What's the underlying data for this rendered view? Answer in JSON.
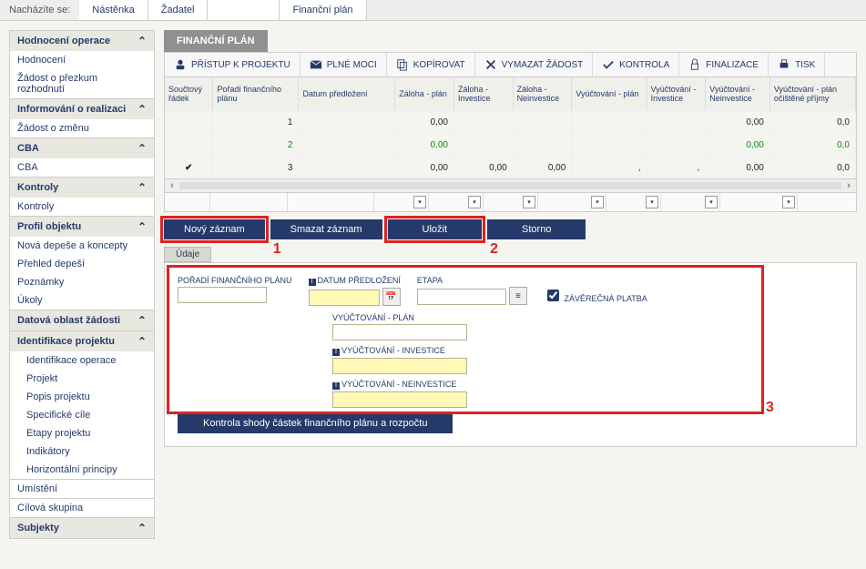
{
  "breadcrumb": {
    "label": "Nacházíte se:",
    "items": [
      "Nástěnka",
      "Žadatel",
      "",
      "Finanční plán"
    ]
  },
  "sidebar": [
    {
      "hd": "Hodnocení operace",
      "items": [
        "Hodnocení",
        "Žádost o přezkum rozhodnutí"
      ]
    },
    {
      "hd": "Informování o realizaci",
      "items": [
        "Žádost o změnu"
      ]
    },
    {
      "hd": "CBA",
      "items": [
        "CBA"
      ]
    },
    {
      "hd": "Kontroly",
      "items": [
        "Kontroly"
      ]
    },
    {
      "hd": "Profil objektu",
      "items": [
        "Nová depeše a koncepty",
        "Přehled depeší",
        "Poznámky",
        "Úkoly"
      ]
    },
    {
      "hd": "Datová oblast žádosti",
      "items": []
    },
    {
      "hd": "Identifikace projektu",
      "items": [
        "Identifikace operace",
        "Projekt",
        "Popis projektu",
        "Specifické cíle",
        "Etapy projektu",
        "Indikátory",
        "Horizontální principy"
      ],
      "sub": true
    },
    {
      "plain": [
        "Umístění",
        "Cílová skupina"
      ]
    },
    {
      "hd": "Subjekty",
      "items": []
    }
  ],
  "tab": "FINANČNÍ PLÁN",
  "toolbar": [
    "PŘÍSTUP K PROJEKTU",
    "PLNÉ MOCI",
    "KOPÍROVAT",
    "VYMAZAT ŽÁDOST",
    "KONTROLA",
    "FINALIZACE",
    "TISK"
  ],
  "gridcols": [
    "Součtový řádek",
    "Pořadí finančního plánu",
    "Datum předložení",
    "Záloha - plán",
    "Záloha - Investice",
    "Záloha - Neinvestice",
    "Vyúčtování - plán",
    "Vyúčtování - Investice",
    "Vyúčtování - Neinvestice",
    "Vyúčtování - plán očištěné příjmy"
  ],
  "rows": [
    {
      "c": [
        "",
        "1",
        "",
        "0,00",
        "",
        "",
        "",
        "",
        "0,00",
        "0,0"
      ]
    },
    {
      "c": [
        "",
        "2",
        "",
        "0,00",
        "",
        "",
        "",
        "",
        "0,00",
        "0,0"
      ]
    },
    {
      "c": [
        "✔",
        "3",
        "",
        "0,00",
        "0,00",
        "0,00",
        ",",
        ",",
        "0,00",
        "0,0"
      ]
    }
  ],
  "btns": {
    "novy": "Nový záznam",
    "smazat": "Smazat záznam",
    "ulozit": "Uložit",
    "storno": "Storno"
  },
  "udaje": "Údaje",
  "form": {
    "poradi": "POŘADÍ FINANČNÍHO PLÁNU",
    "datum": "DATUM PŘEDLOŽENÍ",
    "etapa": "ETAPA",
    "zaver": "Závěrečná platba",
    "vplan": "VYÚČTOVÁNÍ - PLÁN",
    "vinv": "VYÚČTOVÁNÍ - INVESTICE",
    "vneinv": "VYÚČTOVÁNÍ - NEINVESTICE"
  },
  "longbtn": "Kontrola shody částek finančního plánu a rozpočtu",
  "annot": {
    "n1": "1",
    "n2": "2",
    "n3": "3"
  }
}
